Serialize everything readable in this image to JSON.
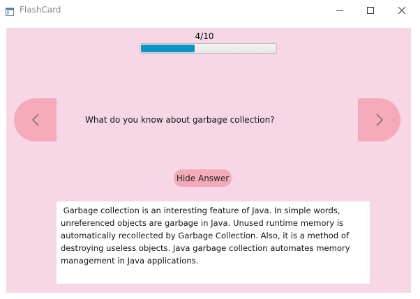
{
  "window": {
    "title": "FlashCard",
    "icons": {
      "app": "app-window-icon",
      "minimize": "minimize-icon",
      "maximize": "maximize-icon",
      "close": "close-icon"
    }
  },
  "progress": {
    "counter_text": "4/10",
    "current": 4,
    "total": 10,
    "fraction": 0.4,
    "fill_color": "#0a93c6"
  },
  "navigation": {
    "prev_icon": "chevron-left-icon",
    "next_icon": "chevron-right-icon",
    "button_color": "#f4aab8"
  },
  "card": {
    "question": "What do you know about garbage collection?",
    "toggle_label": "Hide Answer",
    "answer": " Garbage collection is an interesting feature of Java. In simple words, unreferenced objects are garbage in Java. Unused runtime memory is automatically recollected by Garbage Collection. Also, it is a method of destroying useless objects. Java garbage collection automates memory management in Java applications."
  },
  "colors": {
    "background": "#f7d6e6",
    "accent": "#f4aab8"
  }
}
